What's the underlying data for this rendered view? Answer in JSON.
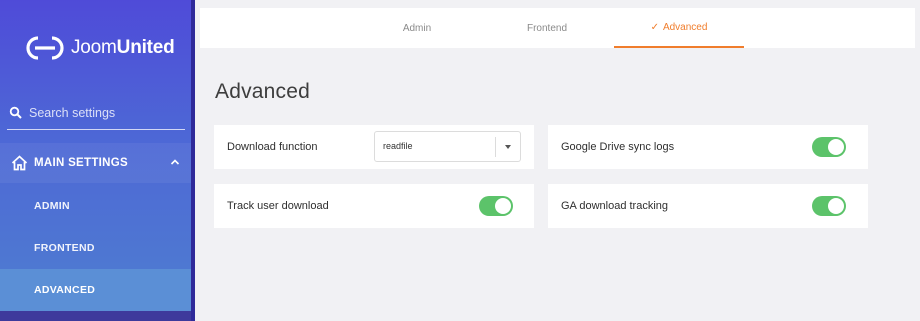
{
  "brand": {
    "name_light": "Joom",
    "name_bold": "United"
  },
  "sidebar": {
    "search_placeholder": "Search settings",
    "section": {
      "label": "MAIN SETTINGS",
      "icon": "home-icon",
      "expanded": true
    },
    "items": [
      {
        "label": "ADMIN",
        "active": false
      },
      {
        "label": "FRONTEND",
        "active": false
      },
      {
        "label": "ADVANCED",
        "active": true
      }
    ]
  },
  "tabs": [
    {
      "label": "Admin",
      "active": false
    },
    {
      "label": "Frontend",
      "active": false
    },
    {
      "label": "Advanced",
      "active": true,
      "check": "✓"
    }
  ],
  "page_title": "Advanced",
  "settings": {
    "download_function": {
      "label": "Download function",
      "value": "readfile"
    },
    "google_drive_sync_logs": {
      "label": "Google Drive sync logs",
      "enabled": true
    },
    "track_user_download": {
      "label": "Track user download",
      "enabled": true
    },
    "ga_download_tracking": {
      "label": "GA download tracking",
      "enabled": true
    }
  },
  "colors": {
    "accent": "#f07d2c",
    "toggle_on": "#5cc36a",
    "sidebar_top": "#4f4bd8",
    "sidebar_bottom": "#4f7fd0"
  }
}
